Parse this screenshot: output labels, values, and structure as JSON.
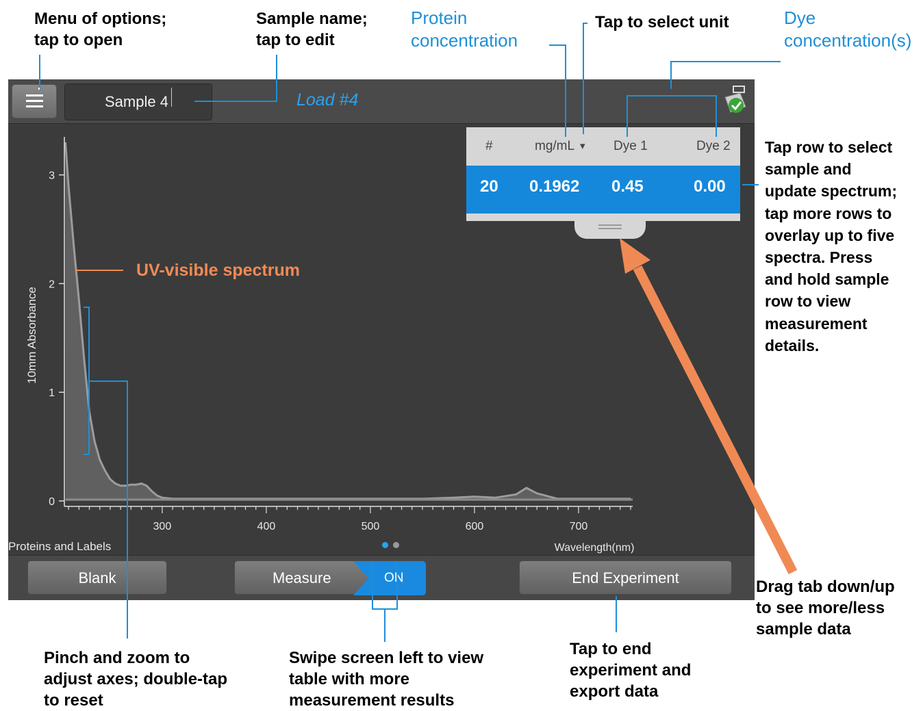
{
  "callouts": {
    "menu": [
      "Menu of options;",
      "tap to open"
    ],
    "sample_name": [
      "Sample name;",
      "tap to edit"
    ],
    "protein_conc": [
      "Protein",
      "concentration"
    ],
    "select_unit": "Tap to select unit",
    "dye_conc": [
      "Dye",
      "concentration(s)"
    ],
    "tap_row": [
      "Tap row to select",
      "sample and",
      "update spectrum;",
      "tap more rows to",
      "overlay up to five",
      "spectra. Press",
      "and hold sample",
      "row to view",
      "measurement",
      "details."
    ],
    "spectrum": "UV-visible spectrum",
    "pinch": [
      "Pinch and zoom to",
      "adjust axes; double-tap",
      "to reset"
    ],
    "swipe": [
      "Swipe screen left to view",
      "table with more",
      "measurement results"
    ],
    "end": [
      "Tap to end",
      "experiment and",
      "export data"
    ],
    "drag": [
      "Drag tab down/up",
      "to see more/less",
      "sample data"
    ]
  },
  "topbar": {
    "sample_name": "Sample 4",
    "load_label": "Load #4"
  },
  "table": {
    "headers": [
      "#",
      "mg/mL",
      "Dye 1",
      "Dye 2"
    ],
    "unit_arrow": "▾",
    "row": [
      "20",
      "0.1962",
      "0.45",
      "0.00"
    ]
  },
  "footer": {
    "app_label": "Proteins and Labels",
    "page_dots": 2,
    "active_dot": 0,
    "active_dot_color": "#29a3ee",
    "inactive_dot_color": "#9a9a9a"
  },
  "buttons": {
    "blank": "Blank",
    "measure": "Measure",
    "toggle": "ON",
    "end": "End Experiment"
  },
  "chart_data": {
    "type": "area",
    "xlabel": "Wavelength(nm)",
    "ylabel": "10mm Absorbance",
    "xlim": [
      206,
      752
    ],
    "ylim": [
      -0.05,
      3.35
    ],
    "xticks": [
      300,
      400,
      500,
      600,
      700
    ],
    "yticks": [
      0,
      1,
      2,
      3
    ],
    "x": [
      207,
      210,
      215,
      220,
      225,
      230,
      235,
      240,
      245,
      250,
      255,
      260,
      265,
      270,
      275,
      280,
      285,
      290,
      295,
      300,
      310,
      320,
      340,
      360,
      400,
      450,
      500,
      550,
      580,
      600,
      620,
      640,
      650,
      660,
      680,
      700,
      720,
      750
    ],
    "series": [
      {
        "values": [
          3.3,
          2.9,
          2.35,
          1.85,
          1.3,
          0.82,
          0.55,
          0.38,
          0.28,
          0.2,
          0.16,
          0.14,
          0.14,
          0.15,
          0.15,
          0.16,
          0.14,
          0.09,
          0.05,
          0.03,
          0.02,
          0.02,
          0.02,
          0.02,
          0.02,
          0.02,
          0.02,
          0.02,
          0.03,
          0.04,
          0.03,
          0.06,
          0.12,
          0.07,
          0.02,
          0.02,
          0.02,
          0.02
        ]
      }
    ]
  }
}
